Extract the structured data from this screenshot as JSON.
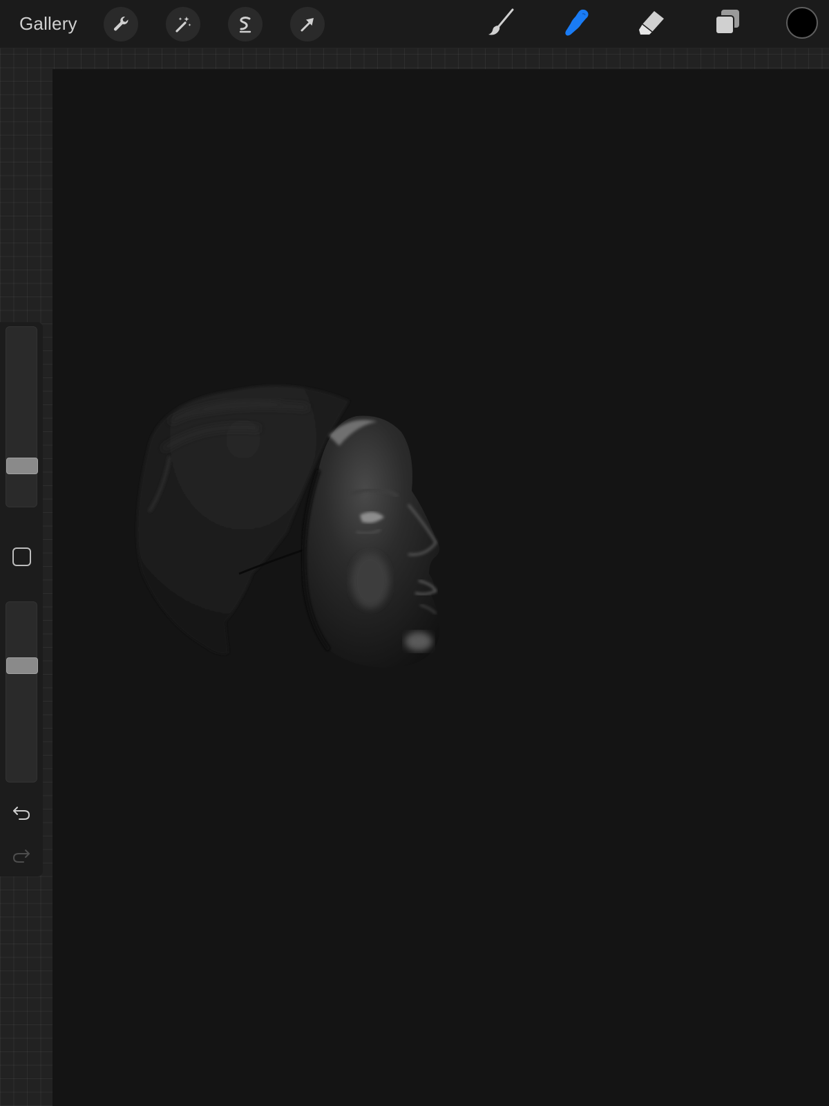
{
  "toolbar": {
    "gallery_label": "Gallery",
    "left_tools": [
      {
        "name": "actions",
        "icon": "wrench-icon"
      },
      {
        "name": "adjustments",
        "icon": "magic-wand-icon"
      },
      {
        "name": "selection",
        "icon": "selection-s-icon"
      },
      {
        "name": "transform",
        "icon": "arrow-cursor-icon"
      }
    ],
    "right_tools": [
      {
        "name": "brush",
        "icon": "paintbrush-icon",
        "active": false
      },
      {
        "name": "smudge",
        "icon": "smudge-finger-icon",
        "active": true
      },
      {
        "name": "eraser",
        "icon": "eraser-icon",
        "active": false
      },
      {
        "name": "layers",
        "icon": "layers-icon",
        "active": false
      }
    ],
    "current_color": "#000000"
  },
  "sidebar": {
    "brush_size_level": 0.2,
    "brush_opacity_level": 0.66,
    "modify_button": "modify-square-icon",
    "undo_icon": "undo-arrow-icon",
    "redo_icon": "redo-arrow-icon",
    "redo_enabled": false
  },
  "colors": {
    "accent_active_tool": "#1a7cf5",
    "canvas_background": "#141414",
    "toolbar_background": "#1b1b1b",
    "toolbar_icon": "#d0d0d0"
  }
}
